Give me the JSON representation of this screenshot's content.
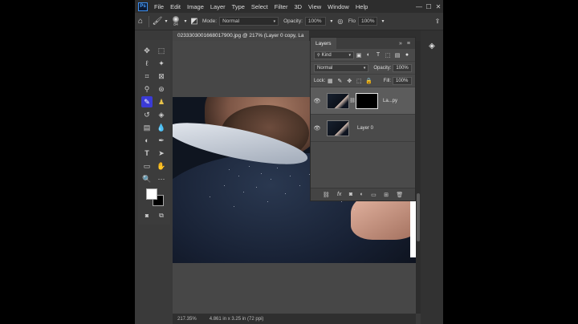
{
  "app": {
    "logo": "Ps",
    "menu": [
      "File",
      "Edit",
      "Image",
      "Layer",
      "Type",
      "Select",
      "Filter",
      "3D",
      "View",
      "Window",
      "Help"
    ],
    "window_controls": [
      "—",
      "☐",
      "✕"
    ]
  },
  "options_bar": {
    "brush_size": "84",
    "mode_label": "Mode:",
    "mode_value": "Normal",
    "opacity_label": "Opacity:",
    "opacity_value": "100%",
    "flow_label": "Flo",
    "flow_value": "100%"
  },
  "document": {
    "tab_title": "0233303001668017900.jpg @ 217% (Layer 0 copy, La"
  },
  "status_bar": {
    "zoom": "217.35%",
    "doc_size": "4.861 in x 3.25 in (72 ppi)"
  },
  "layers_panel": {
    "title": "Layers",
    "kind_label": "Kind",
    "blend_mode": "Normal",
    "opacity_label": "Opacity:",
    "opacity_value": "100%",
    "lock_label": "Lock:",
    "fill_label": "Fill:",
    "fill_value": "100%",
    "layers": [
      {
        "name": "La...py",
        "selected": true,
        "has_mask": true
      },
      {
        "name": "Layer 0",
        "selected": false,
        "has_mask": false
      }
    ]
  },
  "colors": {
    "accent": "#3b3bd6",
    "foreground": "#ffffff",
    "background": "#000000"
  },
  "icons": {
    "home": "home-icon",
    "brush_tool": "brush-icon",
    "move": "move-icon",
    "panel_arrange": "layers-stack-icon"
  }
}
